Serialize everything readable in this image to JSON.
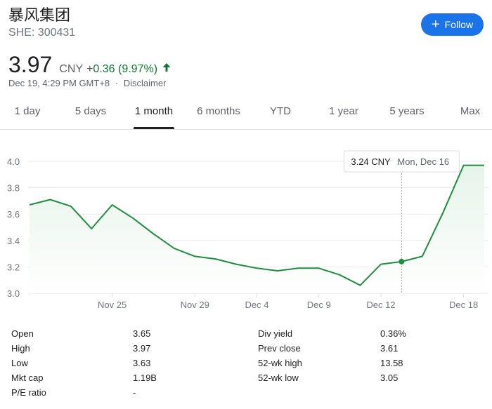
{
  "header": {
    "company": "暴风集团",
    "ticker": "SHE: 300431",
    "follow_label": "Follow"
  },
  "quote": {
    "price": "3.97",
    "currency": "CNY",
    "change": "+0.36 (9.97%)",
    "timestamp": "Dec 19, 4:29 PM GMT+8",
    "separator": "·",
    "disclaimer": "Disclaimer"
  },
  "tabs": [
    {
      "label": "1 day",
      "active": false
    },
    {
      "label": "5 days",
      "active": false
    },
    {
      "label": "1 month",
      "active": true
    },
    {
      "label": "6 months",
      "active": false
    },
    {
      "label": "YTD",
      "active": false
    },
    {
      "label": "1 year",
      "active": false
    },
    {
      "label": "5 years",
      "active": false
    },
    {
      "label": "Max",
      "active": false
    }
  ],
  "chart_data": {
    "type": "area",
    "ylim": [
      3.0,
      4.0
    ],
    "y_ticks": [
      "3.0",
      "3.2",
      "3.4",
      "3.6",
      "3.8",
      "4.0"
    ],
    "x_ticks": [
      "Nov 25",
      "Nov 29",
      "Dec 4",
      "Dec 9",
      "Dec 12",
      "Dec 18"
    ],
    "x": [
      "Nov 21",
      "Nov 22",
      "Nov 23",
      "Nov 24",
      "Nov 25",
      "Nov 26",
      "Nov 27",
      "Nov 28",
      "Nov 29",
      "Nov 30",
      "Dec 1",
      "Dec 2",
      "Dec 3",
      "Dec 4",
      "Dec 5",
      "Dec 6",
      "Dec 7",
      "Dec 8",
      "Dec 9",
      "Dec 10",
      "Dec 11",
      "Dec 12",
      "Dec 13",
      "Dec 14",
      "Dec 15",
      "Dec 16",
      "Dec 17",
      "Dec 18",
      "Dec 19"
    ],
    "values": [
      3.67,
      3.71,
      3.66,
      3.49,
      3.67,
      3.57,
      3.45,
      3.34,
      3.28,
      3.26,
      3.22,
      3.19,
      3.17,
      3.19,
      3.19,
      3.14,
      3.06,
      3.22,
      3.24,
      3.28,
      3.61,
      3.97,
      3.97
    ],
    "tooltip": {
      "value": "3.24 CNY",
      "date": "Mon, Dec 16"
    },
    "line_color": "#1e8e3e",
    "fill_color": "#e6f4ea",
    "grid": true
  },
  "stats": {
    "left": [
      {
        "label": "Open",
        "value": "3.65"
      },
      {
        "label": "High",
        "value": "3.97"
      },
      {
        "label": "Low",
        "value": "3.63"
      },
      {
        "label": "Mkt cap",
        "value": "1.19B"
      },
      {
        "label": "P/E ratio",
        "value": "-"
      }
    ],
    "right": [
      {
        "label": "Div yield",
        "value": "0.36%"
      },
      {
        "label": "Prev close",
        "value": "3.61"
      },
      {
        "label": "52-wk high",
        "value": "13.58"
      },
      {
        "label": "52-wk low",
        "value": "3.05"
      }
    ]
  }
}
